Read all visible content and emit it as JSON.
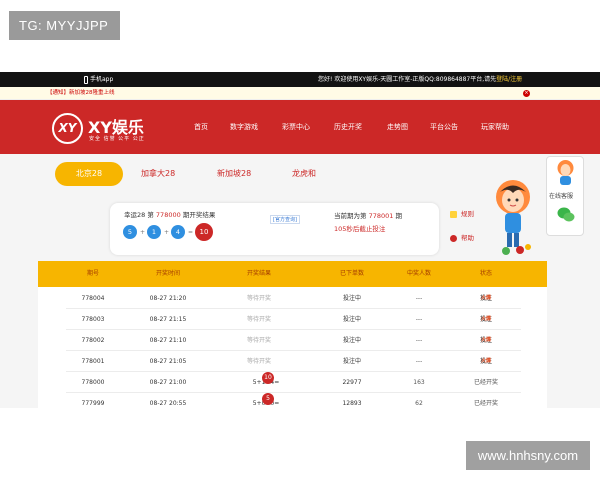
{
  "watermarks": {
    "top_left": "TG: MYYJJPP",
    "bottom_right": "www.hnhsny.com"
  },
  "topbar": {
    "app_link": "手机app",
    "welcome": "您好! 欢迎使用XY娱乐-天圆工作室-正版QQ:809864887平台,请先",
    "login_register": "登陆/注册"
  },
  "notice": {
    "text": "【通知】新加坡28隆重上线"
  },
  "brand": {
    "logo_mark": "XY",
    "name": "XY娱乐",
    "slogan": "安全 信誉 公平 公正"
  },
  "nav": [
    "首页",
    "数字游戏",
    "彩票中心",
    "历史开奖",
    "走势图",
    "平台公告",
    "玩家帮助"
  ],
  "tabs": [
    "北京28",
    "加拿大28",
    "新加坡28",
    "龙虎和"
  ],
  "draw": {
    "prefix": "幸运28 第",
    "period": "778000",
    "suffix": "期开奖结果",
    "balls": [
      "5",
      "1",
      "4"
    ],
    "ops": [
      "+",
      "+",
      "="
    ],
    "sum": "10",
    "official": "[官方查询]",
    "current_prefix": "当前期为第",
    "current_period": "778001",
    "current_suffix": "期",
    "countdown": "105秒后截止投注"
  },
  "side_links": {
    "rules": "规则",
    "help": "帮助"
  },
  "customer_service": {
    "label": "在线客服"
  },
  "table": {
    "headers": [
      "期号",
      "开奖时间",
      "开奖结果",
      "已下单数",
      "中奖人数",
      "状态"
    ],
    "rows": [
      {
        "period": "778004",
        "time": "08-27 21:20",
        "result": "等待开奖",
        "orders": "投注中",
        "winners": "---",
        "status": "投注"
      },
      {
        "period": "778003",
        "time": "08-27 21:15",
        "result": "等待开奖",
        "orders": "投注中",
        "winners": "---",
        "status": "投注"
      },
      {
        "period": "778002",
        "time": "08-27 21:10",
        "result": "等待开奖",
        "orders": "投注中",
        "winners": "---",
        "status": "投注"
      },
      {
        "period": "778001",
        "time": "08-27 21:05",
        "result": "等待开奖",
        "orders": "投注中",
        "winners": "---",
        "status": "投注"
      },
      {
        "period": "778000",
        "time": "08-27 21:00",
        "result": "5+1+4=",
        "sum": "10",
        "orders": "22977",
        "winners": "163",
        "status": "已经开奖"
      },
      {
        "period": "777999",
        "time": "08-27 20:55",
        "result": "5+0+0=",
        "sum": "5",
        "orders": "12893",
        "winners": "62",
        "status": "已经开奖"
      }
    ],
    "hot_tag": "火爆"
  },
  "colors": {
    "primary_red": "#cc2827",
    "accent_yellow": "#f7b500",
    "ball_blue": "#2f8fe0",
    "link_blue": "#3a7bd5"
  }
}
